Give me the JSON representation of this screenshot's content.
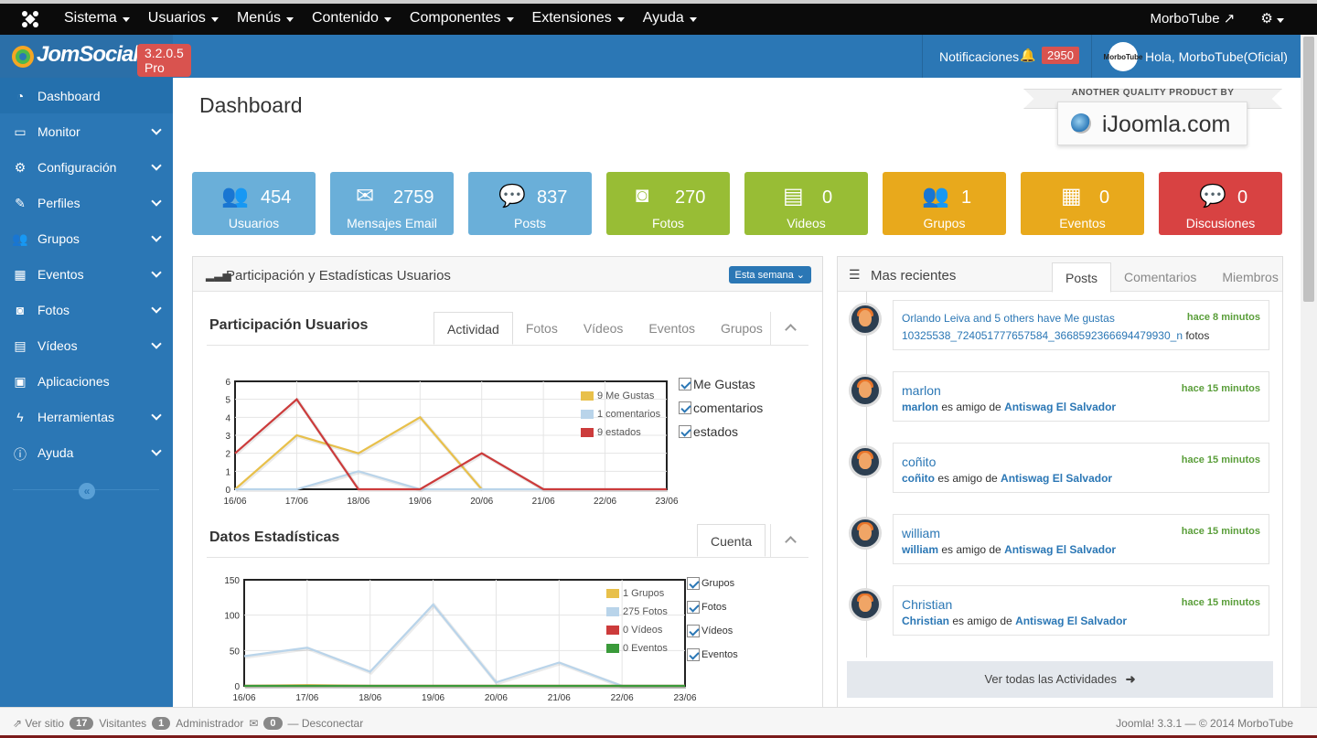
{
  "topnav": {
    "items": [
      "Sistema",
      "Usuarios",
      "Menús",
      "Contenido",
      "Componentes",
      "Extensiones",
      "Ayuda"
    ],
    "user": "MorboTube"
  },
  "header": {
    "brand": "JomSocial",
    "version": "3.2.0.5 Pro",
    "notif_label": "Notificaciones",
    "notif_count": "2950",
    "greeting": "Hola, MorboTube(Oficial)",
    "avatar_text": "MorboTube"
  },
  "sidebar": {
    "items": [
      {
        "label": "Dashboard",
        "icon": "dashboard-icon"
      },
      {
        "label": "Monitor",
        "icon": "monitor-icon"
      },
      {
        "label": "Configuración",
        "icon": "cogs-icon"
      },
      {
        "label": "Perfiles",
        "icon": "edit-icon"
      },
      {
        "label": "Grupos",
        "icon": "users-icon"
      },
      {
        "label": "Eventos",
        "icon": "calendar-icon"
      },
      {
        "label": "Fotos",
        "icon": "camera-icon"
      },
      {
        "label": "Vídeos",
        "icon": "film-icon"
      },
      {
        "label": "Aplicaciones",
        "icon": "briefcase-icon"
      },
      {
        "label": "Herramientas",
        "icon": "bolt-icon"
      },
      {
        "label": "Ayuda",
        "icon": "info-icon"
      }
    ]
  },
  "page": {
    "title": "Dashboard"
  },
  "promo": {
    "label": "ANOTHER QUALITY PRODUCT BY",
    "site": "iJoomla.com"
  },
  "stats": [
    {
      "value": "454",
      "label": "Usuarios",
      "color": "#6aafd9",
      "icon": "users-icon"
    },
    {
      "value": "2759",
      "label": "Mensajes Email",
      "color": "#6aafd9",
      "icon": "envelope-icon"
    },
    {
      "value": "837",
      "label": "Posts",
      "color": "#6aafd9",
      "icon": "comment-icon"
    },
    {
      "value": "270",
      "label": "Fotos",
      "color": "#98bd35",
      "icon": "camera-icon"
    },
    {
      "value": "0",
      "label": "Videos",
      "color": "#98bd35",
      "icon": "film-icon"
    },
    {
      "value": "1",
      "label": "Grupos",
      "color": "#e8a91c",
      "icon": "users-icon"
    },
    {
      "value": "0",
      "label": "Eventos",
      "color": "#e8a91c",
      "icon": "calendar-icon"
    },
    {
      "value": "0",
      "label": "Discusiones",
      "color": "#d84242",
      "icon": "comments-icon"
    }
  ],
  "participation": {
    "panel_title": "Participación y Estadísticas Usuarios",
    "period": "Esta semana",
    "title": "Participación Usuarios",
    "tabs": [
      "Actividad",
      "Fotos",
      "Vídeos",
      "Eventos",
      "Grupos"
    ],
    "checks": [
      "Me Gustas",
      "comentarios",
      "estados"
    ],
    "legend": [
      "9 Me Gustas",
      "1 comentarios",
      "9 estados"
    ]
  },
  "stats_section": {
    "title": "Datos Estadísticas",
    "tab": "Cuenta",
    "checks": [
      "Grupos",
      "Fotos",
      "Vídeos",
      "Eventos"
    ],
    "legend": [
      "1 Grupos",
      "275 Fotos",
      "0 Vídeos",
      "0 Eventos"
    ]
  },
  "recent": {
    "title": "Mas recientes",
    "tabs": [
      "Posts",
      "Comentarios",
      "Miembros"
    ],
    "items": [
      {
        "who": "Orlando Leiva",
        "rest": " and 5 others have Me gustas",
        "when": "hace 8 minutos",
        "link": "10325538_724051777657584_3668592366694479930_n",
        "suffix": " fotos"
      },
      {
        "who": "marlon",
        "when": "hace 15 minutos",
        "actor": "marlon",
        "mid": " es amigo de ",
        "target": "Antiswag El Salvador"
      },
      {
        "who": "coñito",
        "when": "hace 15 minutos",
        "actor": "coñito",
        "mid": " es amigo de ",
        "target": "Antiswag El Salvador"
      },
      {
        "who": "william",
        "when": "hace 15 minutos",
        "actor": "william",
        "mid": " es amigo de ",
        "target": "Antiswag El Salvador"
      },
      {
        "who": "Christian",
        "when": "hace 15 minutos",
        "actor": "Christian",
        "mid": " es amigo de ",
        "target": "Antiswag El Salvador"
      }
    ],
    "all_label": "Ver todas las Actividades"
  },
  "footer": {
    "view_site": "Ver sitio",
    "visitors_count": "17",
    "visitors": "Visitantes",
    "admin_count": "1",
    "admin": "Administrador",
    "msg_count": "0",
    "logout": "Desconectar",
    "right": "Joomla! 3.3.1 — © 2014 MorboTube"
  },
  "chart_data": [
    {
      "type": "line",
      "title": "Participación Usuarios",
      "x": [
        "16/06",
        "17/06",
        "18/06",
        "19/06",
        "20/06",
        "21/06",
        "22/06",
        "23/06"
      ],
      "ylim": [
        0,
        6
      ],
      "series": [
        {
          "name": "9 Me Gustas",
          "color": "#e8c04a",
          "values": [
            0,
            3,
            2,
            4,
            0,
            null,
            null,
            null
          ]
        },
        {
          "name": "1 comentarios",
          "color": "#b9d4ea",
          "values": [
            0,
            0,
            1,
            0,
            0,
            0,
            0,
            0
          ]
        },
        {
          "name": "9 estados",
          "color": "#cc3b3b",
          "values": [
            2,
            5,
            0,
            0,
            2,
            0,
            0,
            0
          ]
        }
      ]
    },
    {
      "type": "line",
      "title": "Datos Estadísticas",
      "x": [
        "16/06",
        "17/06",
        "18/06",
        "19/06",
        "20/06",
        "21/06",
        "22/06",
        "23/06"
      ],
      "ylim": [
        0,
        150
      ],
      "series": [
        {
          "name": "1 Grupos",
          "color": "#e8c04a",
          "values": [
            0,
            1,
            0,
            0,
            0,
            0,
            0,
            0
          ]
        },
        {
          "name": "275 Fotos",
          "color": "#b9d4ea",
          "values": [
            42,
            54,
            20,
            115,
            5,
            33,
            0,
            0
          ]
        },
        {
          "name": "0 Vídeos",
          "color": "#cc3b3b",
          "values": [
            0,
            0,
            0,
            0,
            0,
            0,
            0,
            0
          ]
        },
        {
          "name": "0 Eventos",
          "color": "#3a9a3a",
          "values": [
            0,
            0,
            0,
            0,
            0,
            0,
            0,
            0
          ]
        }
      ]
    }
  ]
}
